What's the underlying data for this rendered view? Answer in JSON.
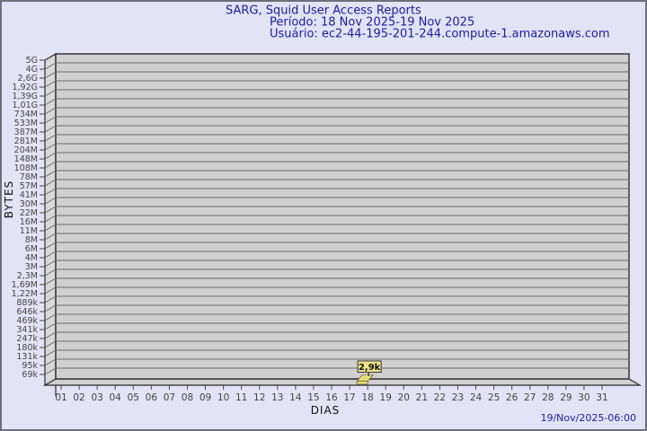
{
  "title": {
    "line1": "SARG, Squid User Access Reports",
    "line2": "Período: 18 Nov 2025-19 Nov 2025",
    "line3": "Usuário: ec2-44-195-201-244.compute-1.amazonaws.com"
  },
  "footer": {
    "timestamp": "19/Nov/2025-06:00"
  },
  "chart_data": {
    "type": "bar",
    "title": "SARG, Squid User Access Reports",
    "subtitle": "Período: 18 Nov 2025-19 Nov 2025",
    "user": "ec2-44-195-201-244.compute-1.amazonaws.com",
    "xlabel": "DIAS",
    "ylabel": "BYTES",
    "y_scale": "log-like (SARG byte buckets)",
    "grid": true,
    "legend_position": "none",
    "y_tick_labels": [
      "5G",
      "4G",
      "2,6G",
      "1,92G",
      "1,39G",
      "1,01G",
      "734M",
      "533M",
      "387M",
      "281M",
      "204M",
      "148M",
      "108M",
      "78M",
      "57M",
      "41M",
      "30M",
      "22M",
      "16M",
      "11M",
      "8M",
      "6M",
      "4M",
      "3M",
      "2,3M",
      "1,69M",
      "1,22M",
      "889k",
      "646k",
      "469k",
      "341k",
      "247k",
      "180k",
      "131k",
      "95k",
      "69k"
    ],
    "x_tick_labels": [
      "01",
      "02",
      "03",
      "04",
      "05",
      "06",
      "07",
      "08",
      "09",
      "10",
      "11",
      "12",
      "13",
      "14",
      "15",
      "16",
      "17",
      "18",
      "19",
      "20",
      "21",
      "22",
      "23",
      "24",
      "25",
      "26",
      "27",
      "28",
      "29",
      "30",
      "31"
    ],
    "points": [
      {
        "day": "18",
        "label": "2,9k",
        "value_bytes": 2900
      }
    ],
    "ylim_labels": [
      "69k",
      "5G"
    ]
  },
  "colors": {
    "background": "#e3e3f6",
    "frame_border": "#6f6f7a",
    "plot_fill": "#d0d0d0",
    "wall_fill": "#d9d9d9",
    "gridline": "#6a6a6a",
    "outline": "#2b2b2b",
    "title_text": "#1c1ca0",
    "tick_text": "#454545",
    "axis_text": "#111111",
    "marker_fill": "#f0e68c",
    "marker_bar_fill": "#e9db7d",
    "marker_border": "#4d4d1a",
    "timestamp_text": "#1c1ca0"
  }
}
